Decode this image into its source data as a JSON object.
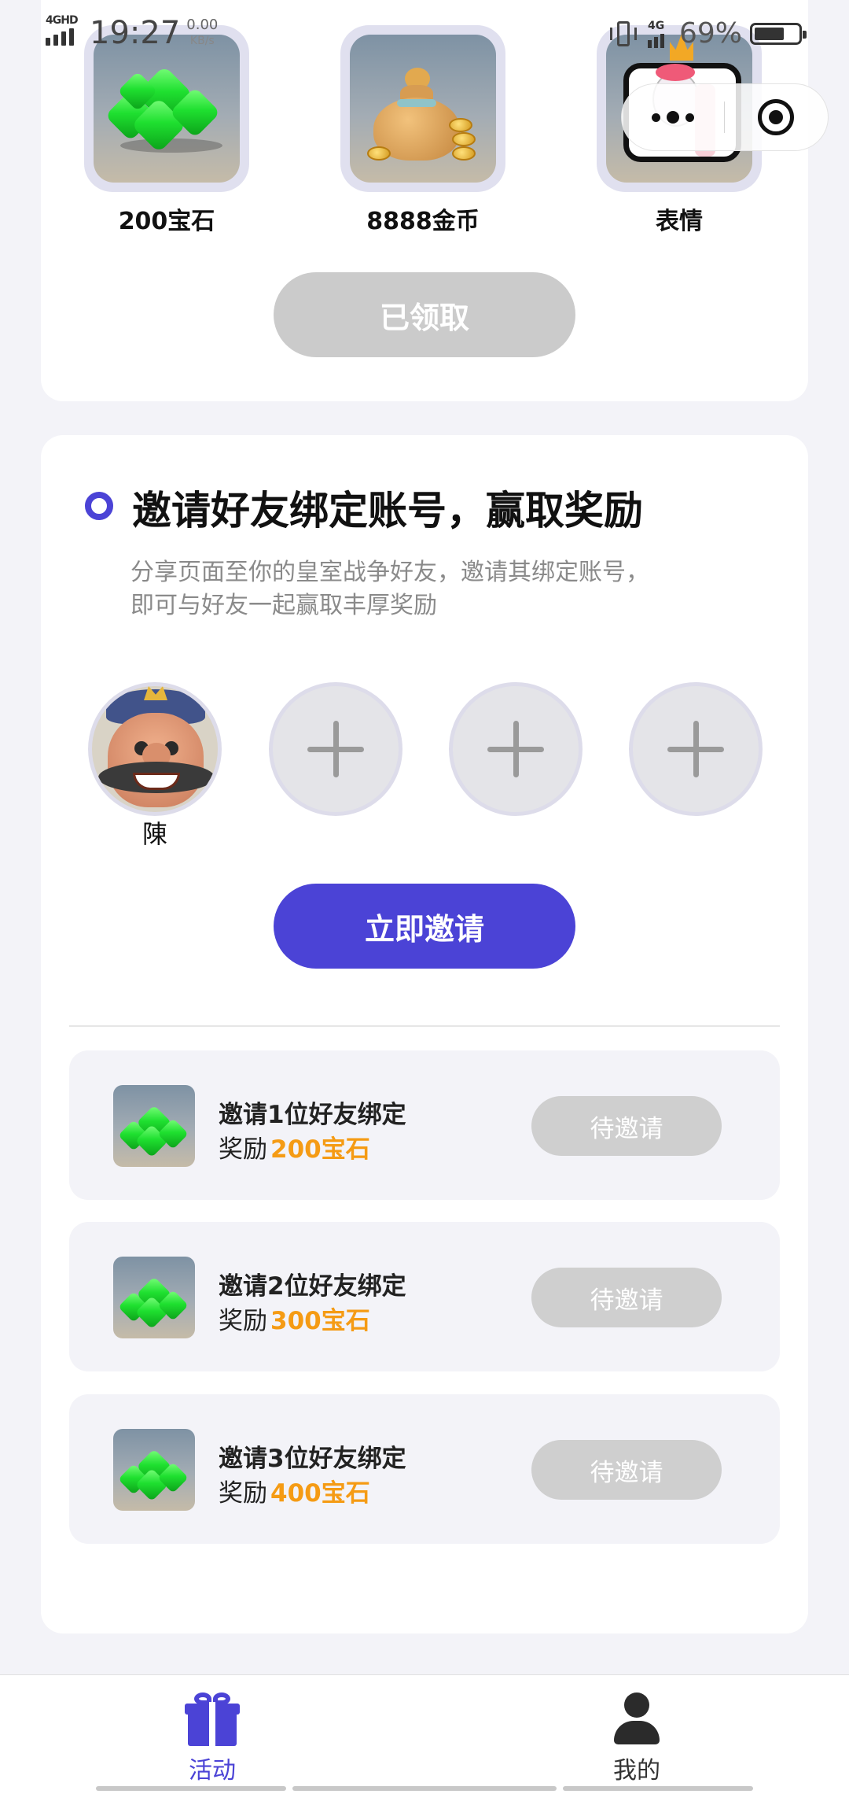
{
  "status_bar": {
    "network": "4GHD",
    "time": "19:27",
    "speed_value": "0.00",
    "speed_unit": "KB/s",
    "mobile_data": "4G",
    "battery_percent": "69%",
    "battery_level": 0.69
  },
  "rewards": {
    "items": [
      {
        "label": "200宝石",
        "icon": "gems-icon"
      },
      {
        "label": "8888金币",
        "icon": "money-bag-icon"
      },
      {
        "label": "表情",
        "icon": "emoji-sticker-icon"
      }
    ],
    "claim_button": "已领取"
  },
  "invite": {
    "title": "邀请好友绑定账号，赢取奖励",
    "desc_line1": "分享页面至你的皇室战争好友，邀请其绑定账号，",
    "desc_line2": "即可与好友一起赢取丰厚奖励",
    "friends": [
      {
        "name": "陳",
        "filled": true
      },
      {
        "name": "",
        "filled": false
      },
      {
        "name": "",
        "filled": false
      },
      {
        "name": "",
        "filled": false
      }
    ],
    "invite_button": "立即邀请",
    "tiers": [
      {
        "title": "邀请1位好友绑定",
        "reward_prefix": "奖励",
        "reward_amount": "200宝石",
        "button": "待邀请"
      },
      {
        "title": "邀请2位好友绑定",
        "reward_prefix": "奖励",
        "reward_amount": "300宝石",
        "button": "待邀请"
      },
      {
        "title": "邀请3位好友绑定",
        "reward_prefix": "奖励",
        "reward_amount": "400宝石",
        "button": "待邀请"
      }
    ]
  },
  "tabbar": {
    "tabs": [
      {
        "label": "活动",
        "icon": "gift-icon",
        "active": true
      },
      {
        "label": "我的",
        "icon": "user-icon",
        "active": false
      }
    ]
  },
  "colors": {
    "accent": "#4b43d6",
    "reward_orange": "#f59b14",
    "disabled_button": "#cbcbcb",
    "background": "#f3f3f8"
  }
}
